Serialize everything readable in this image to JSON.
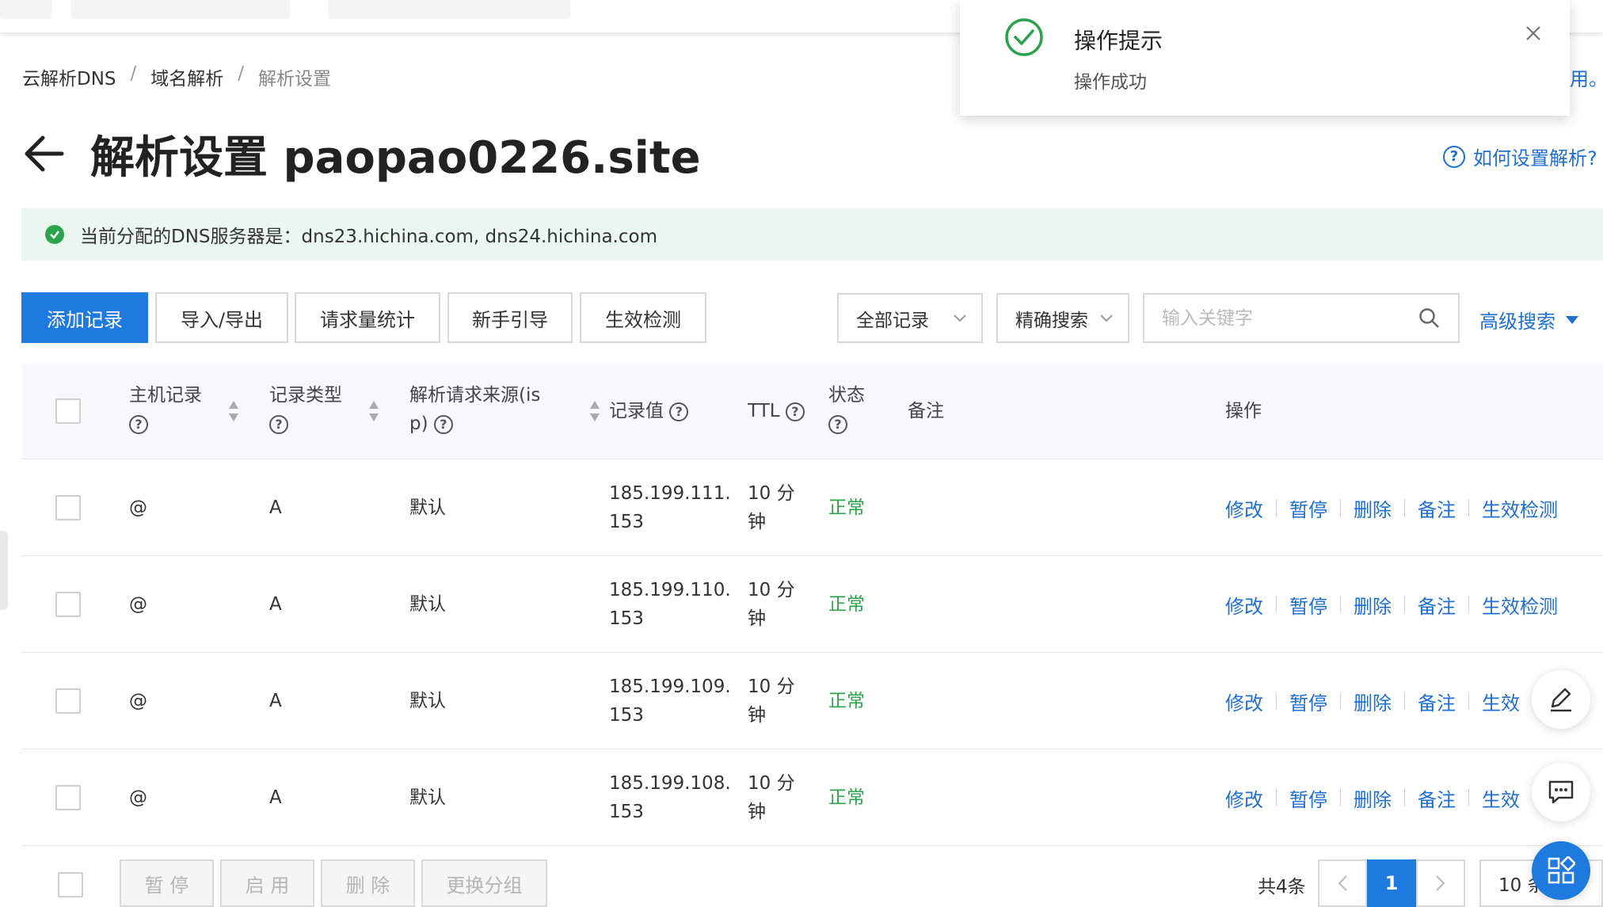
{
  "toast": {
    "title": "操作提示",
    "message": "操作成功",
    "icon": "check-circle-icon",
    "color": "#2ba24c"
  },
  "partial_notice": "用。",
  "breadcrumb": {
    "items": [
      "云解析DNS",
      "域名解析",
      "解析设置"
    ],
    "separator": "/"
  },
  "page": {
    "title": "解析设置 paopao0226.site",
    "help_link": "如何设置解析?"
  },
  "dns_banner": {
    "text": "当前分配的DNS服务器是：dns23.hichina.com, dns24.hichina.com"
  },
  "toolbar": {
    "add_record": "添加记录",
    "import_export": "导入/导出",
    "request_stats": "请求量统计",
    "guide": "新手引导",
    "effect_check": "生效检测",
    "filter_all": "全部记录",
    "search_mode": "精确搜索",
    "search_placeholder": "输入关键字",
    "advanced_search": "高级搜索"
  },
  "table": {
    "headers": {
      "host_line1": "主机记录",
      "type_line1": "记录类型",
      "isp_line1": "解析请求来源(is",
      "isp_line2": "p)",
      "value": "记录值",
      "ttl": "TTL",
      "status": "状态",
      "remark": "备注",
      "actions": "操作"
    },
    "rows": [
      {
        "host": "@",
        "type": "A",
        "isp": "默认",
        "value_line1": "185.199.111.",
        "value_line2": "153",
        "ttl_line1": "10 分",
        "ttl_line2": "钟",
        "status": "正常"
      },
      {
        "host": "@",
        "type": "A",
        "isp": "默认",
        "value_line1": "185.199.110.",
        "value_line2": "153",
        "ttl_line1": "10 分",
        "ttl_line2": "钟",
        "status": "正常"
      },
      {
        "host": "@",
        "type": "A",
        "isp": "默认",
        "value_line1": "185.199.109.",
        "value_line2": "153",
        "ttl_line1": "10 分",
        "ttl_line2": "钟",
        "status": "正常"
      },
      {
        "host": "@",
        "type": "A",
        "isp": "默认",
        "value_line1": "185.199.108.",
        "value_line2": "153",
        "ttl_line1": "10 分",
        "ttl_line2": "钟",
        "status": "正常"
      }
    ],
    "row_actions": [
      "修改",
      "暂停",
      "删除",
      "备注",
      "生效检测"
    ],
    "row_actions_truncated": "生效"
  },
  "bulk": {
    "pause": "暂 停",
    "enable": "启 用",
    "delete": "删 除",
    "change_group": "更换分组"
  },
  "pagination": {
    "total": "共4条",
    "current_page": "1",
    "page_size": "10 条"
  },
  "colors": {
    "primary": "#1f7ae0",
    "link": "#1f6fd1",
    "success": "#2ba24c",
    "banner_bg": "#e9f7ee"
  }
}
